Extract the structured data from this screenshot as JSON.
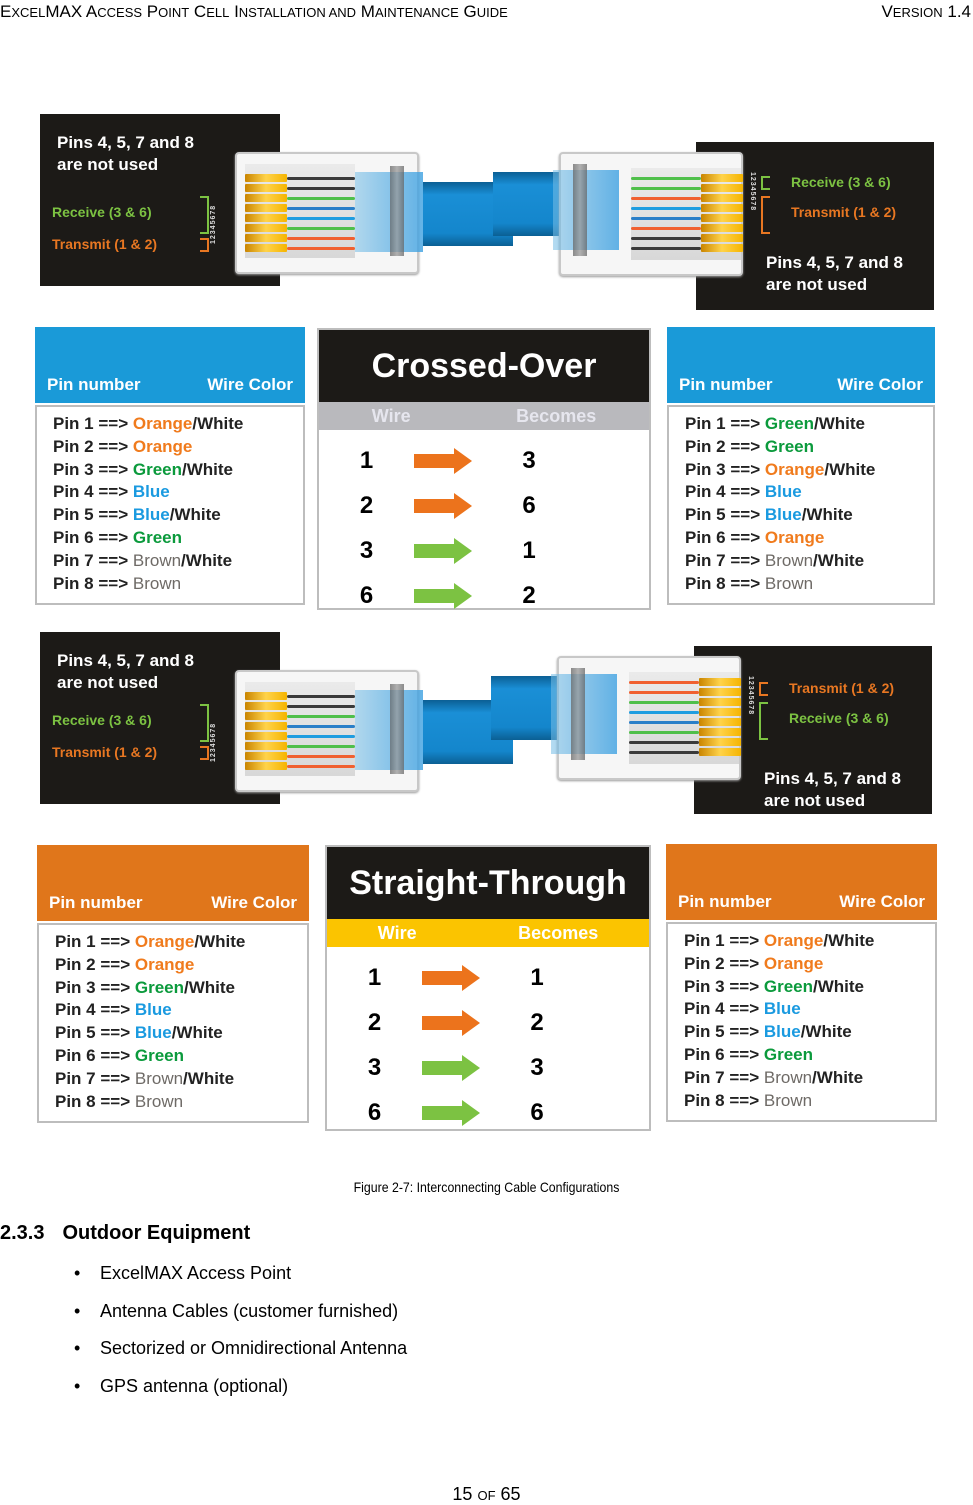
{
  "header": {
    "title_parts": [
      {
        "big": "E",
        "small": "XCEL"
      },
      {
        "big": "MAX A",
        "small": "CCESS"
      },
      {
        "big": " P",
        "small": "OINT"
      },
      {
        "big": " C",
        "small": "ELL"
      },
      {
        "big": " I",
        "small": "NSTALLATION AND"
      },
      {
        "big": " M",
        "small": "AINTENANCE"
      },
      {
        "big": " G",
        "small": "UIDE"
      }
    ],
    "title": "ExcelMAX Access Point Cell Installation and Maintenance Guide",
    "version_big": "V",
    "version_small": "ERSION",
    "version_num": " 1.4"
  },
  "figure": {
    "crossover": {
      "left_connector": {
        "unused_note": [
          "Pins 4, 5, 7 and 8",
          "are not used"
        ],
        "receive_label": "Receive (3 & 6)",
        "transmit_label": "Transmit (1 & 2)",
        "pin_numbers": "12345678",
        "wire_colors": [
          "#3a3a3a",
          "#3a3a3a",
          "#4fbf4a",
          "#2a7fc8",
          "#1f9de0",
          "#4fbf4a",
          "#f06030",
          "#f06030"
        ]
      },
      "right_connector": {
        "unused_note": [
          "Pins 4, 5, 7 and 8",
          "are not used"
        ],
        "receive_label": "Receive (3 & 6)",
        "transmit_label": "Transmit (1 & 2)",
        "pin_numbers": "12345678",
        "wire_colors": [
          "#4fbf4a",
          "#4fbf4a",
          "#f06030",
          "#1f9de0",
          "#2a7fc8",
          "#f06030",
          "#3a3a3a",
          "#3a3a3a"
        ]
      },
      "left_table": {
        "header": {
          "pin": "Pin number",
          "color": "Wire Color"
        },
        "header_color": "#1a9ad8",
        "rows": [
          {
            "pin": "Pin 1 ==> ",
            "color": "Orange",
            "cls": "c-orange",
            "suffix": "/White"
          },
          {
            "pin": "Pin 2 ==> ",
            "color": "Orange",
            "cls": "c-orange",
            "suffix": ""
          },
          {
            "pin": "Pin 3 ==> ",
            "color": "Green",
            "cls": "c-green",
            "suffix": "/White"
          },
          {
            "pin": "Pin 4 ==> ",
            "color": "Blue",
            "cls": "c-blue",
            "suffix": ""
          },
          {
            "pin": "Pin 5 ==> ",
            "color": "Blue",
            "cls": "c-blue",
            "suffix": "/White"
          },
          {
            "pin": "Pin 6 ==> ",
            "color": "Green",
            "cls": "c-green",
            "suffix": ""
          },
          {
            "pin": "Pin 7 ==> ",
            "color": "Brown",
            "cls": "c-brown",
            "suffix": "/White"
          },
          {
            "pin": "Pin 8 ==> ",
            "color": "Brown",
            "cls": "c-brown",
            "suffix": ""
          }
        ]
      },
      "mapping": {
        "title": "Crossed-Over",
        "col_wire": "Wire",
        "col_becomes": "Becomes",
        "rows": [
          {
            "from": "1",
            "to": "3",
            "arrow": "orange"
          },
          {
            "from": "2",
            "to": "6",
            "arrow": "orange"
          },
          {
            "from": "3",
            "to": "1",
            "arrow": "green"
          },
          {
            "from": "6",
            "to": "2",
            "arrow": "green"
          }
        ]
      },
      "right_table": {
        "header": {
          "pin": "Pin number",
          "color": "Wire Color"
        },
        "header_color": "#1a9ad8",
        "rows": [
          {
            "pin": "Pin 1 ==> ",
            "color": "Green",
            "cls": "c-green",
            "suffix": "/White"
          },
          {
            "pin": "Pin 2 ==> ",
            "color": "Green",
            "cls": "c-green",
            "suffix": ""
          },
          {
            "pin": "Pin 3 ==> ",
            "color": "Orange",
            "cls": "c-orange",
            "suffix": "/White"
          },
          {
            "pin": "Pin 4 ==> ",
            "color": "Blue",
            "cls": "c-blue",
            "suffix": ""
          },
          {
            "pin": "Pin 5 ==> ",
            "color": "Blue",
            "cls": "c-blue",
            "suffix": "/White"
          },
          {
            "pin": "Pin 6 ==> ",
            "color": "Orange",
            "cls": "c-orange",
            "suffix": ""
          },
          {
            "pin": "Pin 7 ==> ",
            "color": "Brown",
            "cls": "c-brown",
            "suffix": "/White"
          },
          {
            "pin": "Pin 8 ==> ",
            "color": "Brown",
            "cls": "c-brown",
            "suffix": ""
          }
        ]
      }
    },
    "straight": {
      "left_connector": {
        "unused_note": [
          "Pins 4, 5, 7 and 8",
          "are not used"
        ],
        "receive_label": "Receive (3 & 6)",
        "transmit_label": "Transmit (1 & 2)",
        "pin_numbers": "12345678",
        "wire_colors": [
          "#3a3a3a",
          "#3a3a3a",
          "#4fbf4a",
          "#2a7fc8",
          "#1f9de0",
          "#4fbf4a",
          "#f06030",
          "#f06030"
        ]
      },
      "right_connector": {
        "unused_note": [
          "Pins 4, 5, 7 and 8",
          "are not used"
        ],
        "receive_label": "Receive (3 & 6)",
        "transmit_label": "Transmit (1 & 2)",
        "pin_numbers": "12345678",
        "wire_colors": [
          "#f06030",
          "#f06030",
          "#4fbf4a",
          "#1f9de0",
          "#2a7fc8",
          "#4fbf4a",
          "#3a3a3a",
          "#3a3a3a"
        ]
      },
      "left_table": {
        "header": {
          "pin": "Pin number",
          "color": "Wire Color"
        },
        "header_color": "#e0761b",
        "rows": [
          {
            "pin": "Pin 1 ==> ",
            "color": "Orange",
            "cls": "c-orange",
            "suffix": "/White"
          },
          {
            "pin": "Pin 2 ==> ",
            "color": "Orange",
            "cls": "c-orange",
            "suffix": ""
          },
          {
            "pin": "Pin 3 ==> ",
            "color": "Green",
            "cls": "c-green",
            "suffix": "/White"
          },
          {
            "pin": "Pin 4 ==> ",
            "color": "Blue",
            "cls": "c-blue",
            "suffix": ""
          },
          {
            "pin": "Pin 5 ==> ",
            "color": "Blue",
            "cls": "c-blue",
            "suffix": "/White"
          },
          {
            "pin": "Pin 6 ==> ",
            "color": "Green",
            "cls": "c-green",
            "suffix": ""
          },
          {
            "pin": "Pin 7 ==> ",
            "color": "Brown",
            "cls": "c-brown",
            "suffix": "/White"
          },
          {
            "pin": "Pin 8 ==> ",
            "color": "Brown",
            "cls": "c-brown",
            "suffix": ""
          }
        ]
      },
      "mapping": {
        "title": "Straight-Through",
        "col_wire": "Wire",
        "col_becomes": "Becomes",
        "rows": [
          {
            "from": "1",
            "to": "1",
            "arrow": "orange"
          },
          {
            "from": "2",
            "to": "2",
            "arrow": "orange"
          },
          {
            "from": "3",
            "to": "3",
            "arrow": "green"
          },
          {
            "from": "6",
            "to": "6",
            "arrow": "green"
          }
        ]
      },
      "right_table": {
        "header": {
          "pin": "Pin number",
          "color": "Wire Color"
        },
        "header_color": "#e0761b",
        "rows": [
          {
            "pin": "Pin 1 ==> ",
            "color": "Orange",
            "cls": "c-orange",
            "suffix": "/White"
          },
          {
            "pin": "Pin 2 ==> ",
            "color": "Orange",
            "cls": "c-orange",
            "suffix": ""
          },
          {
            "pin": "Pin 3 ==> ",
            "color": "Green",
            "cls": "c-green",
            "suffix": "/White"
          },
          {
            "pin": "Pin 4 ==> ",
            "color": "Blue",
            "cls": "c-blue",
            "suffix": ""
          },
          {
            "pin": "Pin 5 ==> ",
            "color": "Blue",
            "cls": "c-blue",
            "suffix": "/White"
          },
          {
            "pin": "Pin 6 ==> ",
            "color": "Green",
            "cls": "c-green",
            "suffix": ""
          },
          {
            "pin": "Pin 7 ==> ",
            "color": "Brown",
            "cls": "c-brown",
            "suffix": "/White"
          },
          {
            "pin": "Pin 8 ==> ",
            "color": "Brown",
            "cls": "c-brown",
            "suffix": ""
          }
        ]
      }
    },
    "caption": "Figure 2-7:  Interconnecting Cable Configurations"
  },
  "section": {
    "number": "2.3.3",
    "title": "Outdoor Equipment",
    "bullets": [
      "ExcelMAX Access Point",
      "Antenna Cables (customer furnished)",
      "Sectorized or Omnidirectional Antenna",
      "GPS antenna (optional)"
    ]
  },
  "footer": {
    "page": "15",
    "of": "OF",
    "total": "65"
  }
}
